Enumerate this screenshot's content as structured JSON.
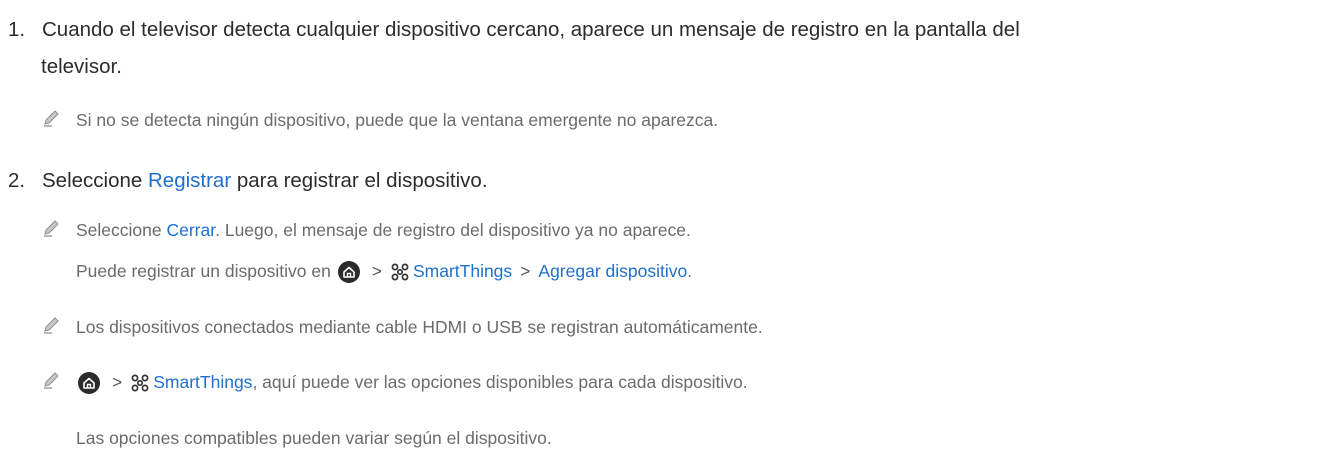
{
  "steps": [
    {
      "number": "1.",
      "text_line1": "Cuando el televisor detecta cualquier dispositivo cercano, aparece un mensaje de registro en la pantalla del",
      "text_line2": "televisor.",
      "note": "Si no se detecta ningún dispositivo, puede que la ventana emergente no aparezca."
    },
    {
      "number": "2.",
      "text_before": "Seleccione ",
      "highlight": "Registrar",
      "text_after": " para registrar el dispositivo."
    }
  ],
  "notes": {
    "cerrar": {
      "before": "Seleccione ",
      "highlight": "Cerrar",
      "after": ". Luego, el mensaje de registro del dispositivo ya no aparece."
    },
    "path_line": {
      "before": "Puede registrar un dispositivo en ",
      "smartthings": "SmartThings",
      "agregar": "Agregar dispositivo",
      "after": "."
    },
    "hdmi": "Los dispositivos conectados mediante cable HDMI o USB se registran automáticamente.",
    "options": {
      "smartthings": "SmartThings",
      "after": ", aquí puede ver las opciones disponibles para cada dispositivo."
    },
    "compatible": "Las opciones compatibles pueden variar según el dispositivo."
  },
  "glyphs": {
    "chevron": ">"
  },
  "icons": {
    "note": "pencil-icon",
    "home": "home-icon",
    "smartthings": "smartthings-icon"
  },
  "colors": {
    "link": "#1f6fcf",
    "body": "#2c2c2c",
    "note": "#6b6b6b"
  }
}
